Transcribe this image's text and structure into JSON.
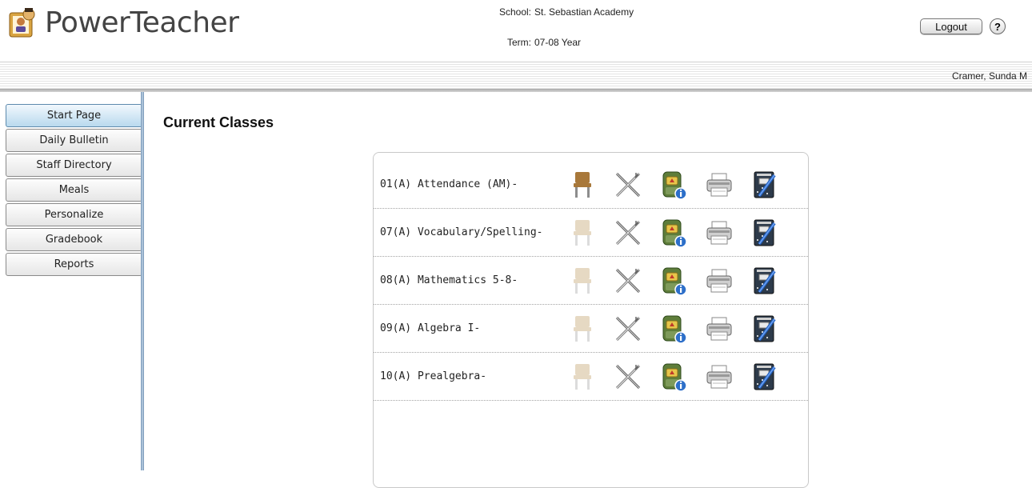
{
  "header": {
    "app_name": "PowerTeacher",
    "school_label": "School:",
    "school_value": "St. Sebastian Academy",
    "term_label": "Term:",
    "term_value": "07-08 Year",
    "logout_label": "Logout",
    "help_label": "?",
    "user_name": "Cramer, Sunda M"
  },
  "sidebar": {
    "items": [
      {
        "label": "Start Page",
        "active": true
      },
      {
        "label": "Daily Bulletin"
      },
      {
        "label": "Staff Directory"
      },
      {
        "label": "Meals"
      },
      {
        "label": "Personalize"
      },
      {
        "label": "Gradebook"
      },
      {
        "label": "Reports"
      }
    ]
  },
  "main": {
    "title": "Current Classes",
    "classes": [
      {
        "label": "01(A)  Attendance (AM)-",
        "seating_active": true
      },
      {
        "label": "07(A)  Vocabulary/Spelling-",
        "seating_active": false
      },
      {
        "label": "08(A)  Mathematics 5-8-",
        "seating_active": false
      },
      {
        "label": "09(A)  Algebra I-",
        "seating_active": false
      },
      {
        "label": "10(A)  Prealgebra-",
        "seating_active": false
      }
    ],
    "row_icons": [
      "chair-icon",
      "tools-icon",
      "backpack-info-icon",
      "printer-icon",
      "gradebook-icon"
    ]
  },
  "colors": {
    "active_nav": "#b9d9ee",
    "divider": "#6f8fb0",
    "chair_active": "#a8783a",
    "chair_inactive": "#e6d9c3"
  }
}
